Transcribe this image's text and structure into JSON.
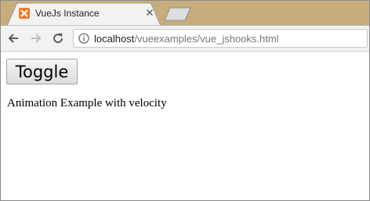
{
  "browser": {
    "tab_title": "VueJs Instance",
    "url_host": "localhost",
    "url_path": "/vueexamples/vue_jshooks.html",
    "favicon": "xampp-icon",
    "favicon_color": "#f37a27",
    "tabstrip_color": "#c8ad7c"
  },
  "page": {
    "toggle_label": "Toggle",
    "text": "Animation Example with velocity"
  }
}
